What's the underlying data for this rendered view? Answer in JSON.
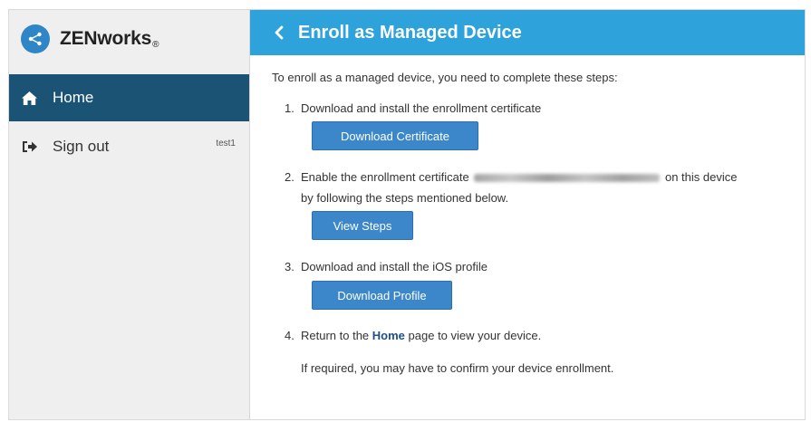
{
  "brand": {
    "name": "ZENworks",
    "trademark": "®",
    "logo_icon": "share-icon"
  },
  "sidebar": {
    "items": [
      {
        "label": "Home",
        "icon": "home-icon",
        "active": true
      },
      {
        "label": "Sign out",
        "icon": "sign-out-icon",
        "user": "test1"
      }
    ]
  },
  "header": {
    "title": "Enroll as Managed Device",
    "back_icon": "chevron-left-icon"
  },
  "main": {
    "intro": "To enroll as a managed device, you need to complete these steps:",
    "steps": [
      {
        "num": "1.",
        "text": "Download and install the enrollment certificate",
        "button": "Download Certificate"
      },
      {
        "num": "2.",
        "text_before": "Enable the enrollment certificate",
        "text_after": "on this device",
        "text_line2": "by following the steps mentioned below.",
        "button": "View Steps"
      },
      {
        "num": "3.",
        "text": "Download and install the iOS profile",
        "button": "Download Profile"
      },
      {
        "num": "4.",
        "text_before": "Return to the",
        "link": "Home",
        "text_after": "page to view your device.",
        "note": "If required, you may have to confirm your device enrollment."
      }
    ]
  },
  "colors": {
    "header": "#2ea2db",
    "sidebar_active": "#1a5373",
    "button": "#3b87c9",
    "sidebar_bg": "#efefef"
  }
}
